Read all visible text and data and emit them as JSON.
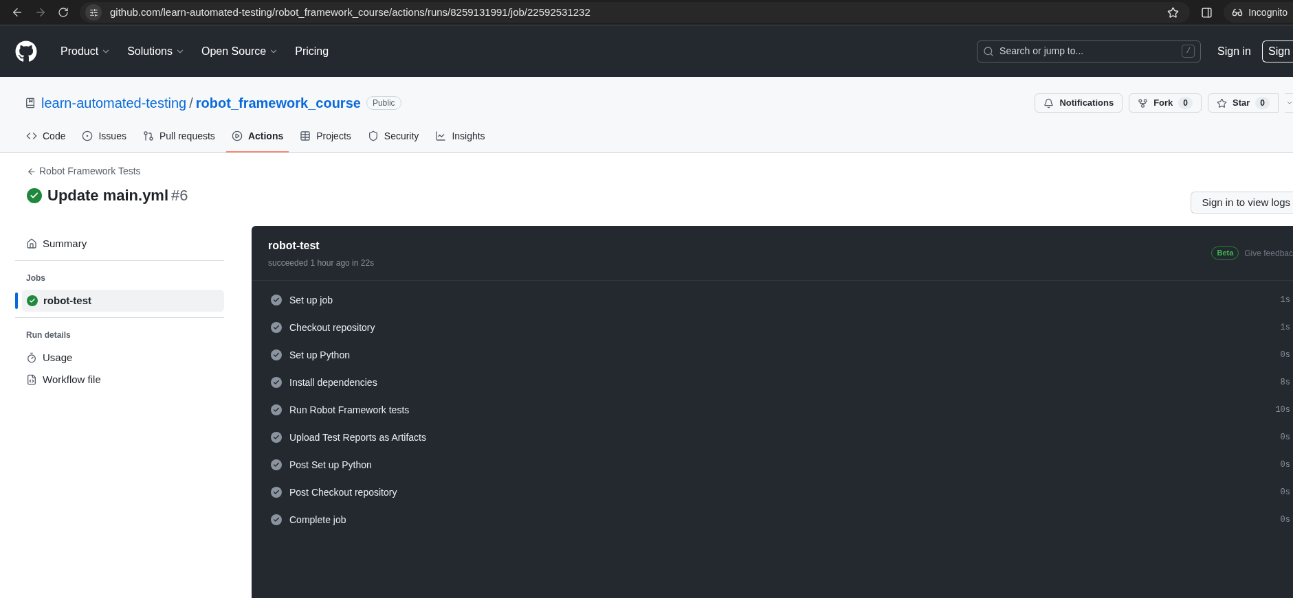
{
  "browser": {
    "url": "github.com/learn-automated-testing/robot_framework_course/actions/runs/8259131991/job/22592531232",
    "profile": "Incognito"
  },
  "header": {
    "nav": [
      {
        "label": "Product",
        "dropdown": true
      },
      {
        "label": "Solutions",
        "dropdown": true
      },
      {
        "label": "Open Source",
        "dropdown": true
      },
      {
        "label": "Pricing",
        "dropdown": false
      }
    ],
    "search": {
      "placeholder": "Search or jump to...",
      "shortcut": "/"
    },
    "sign_in": "Sign in",
    "sign_up": "Sign"
  },
  "repo": {
    "owner": "learn-automated-testing",
    "separator": "/",
    "name": "robot_framework_course",
    "visibility": "Public",
    "actions": [
      {
        "label": "Notifications"
      },
      {
        "label": "Fork",
        "count": "0"
      },
      {
        "label": "Star",
        "count": "0"
      }
    ],
    "tabs": [
      {
        "label": "Code",
        "selected": false
      },
      {
        "label": "Issues",
        "selected": false
      },
      {
        "label": "Pull requests",
        "selected": false
      },
      {
        "label": "Actions",
        "selected": true
      },
      {
        "label": "Projects",
        "selected": false
      },
      {
        "label": "Security",
        "selected": false
      },
      {
        "label": "Insights",
        "selected": false
      }
    ]
  },
  "run": {
    "back_link": "Robot Framework Tests",
    "title": "Update main.yml",
    "number": "#6",
    "sign_in_logs": "Sign in to view logs"
  },
  "sidebar": {
    "summary": "Summary",
    "jobs_heading": "Jobs",
    "jobs": [
      {
        "name": "robot-test",
        "selected": true
      }
    ],
    "run_details_heading": "Run details",
    "run_details": [
      "Usage",
      "Workflow file"
    ]
  },
  "job": {
    "name": "robot-test",
    "summary": "succeeded 1 hour ago in 22s",
    "beta": "Beta",
    "feedback": "Give feedbac",
    "steps": [
      {
        "name": "Set up job",
        "duration": "1s"
      },
      {
        "name": "Checkout repository",
        "duration": "1s"
      },
      {
        "name": "Set up Python",
        "duration": "0s"
      },
      {
        "name": "Install dependencies",
        "duration": "8s"
      },
      {
        "name": "Run Robot Framework tests",
        "duration": "10s"
      },
      {
        "name": "Upload Test Reports as Artifacts",
        "duration": "0s"
      },
      {
        "name": "Post Set up Python",
        "duration": "0s"
      },
      {
        "name": "Post Checkout repository",
        "duration": "0s"
      },
      {
        "name": "Complete job",
        "duration": "0s"
      }
    ]
  }
}
